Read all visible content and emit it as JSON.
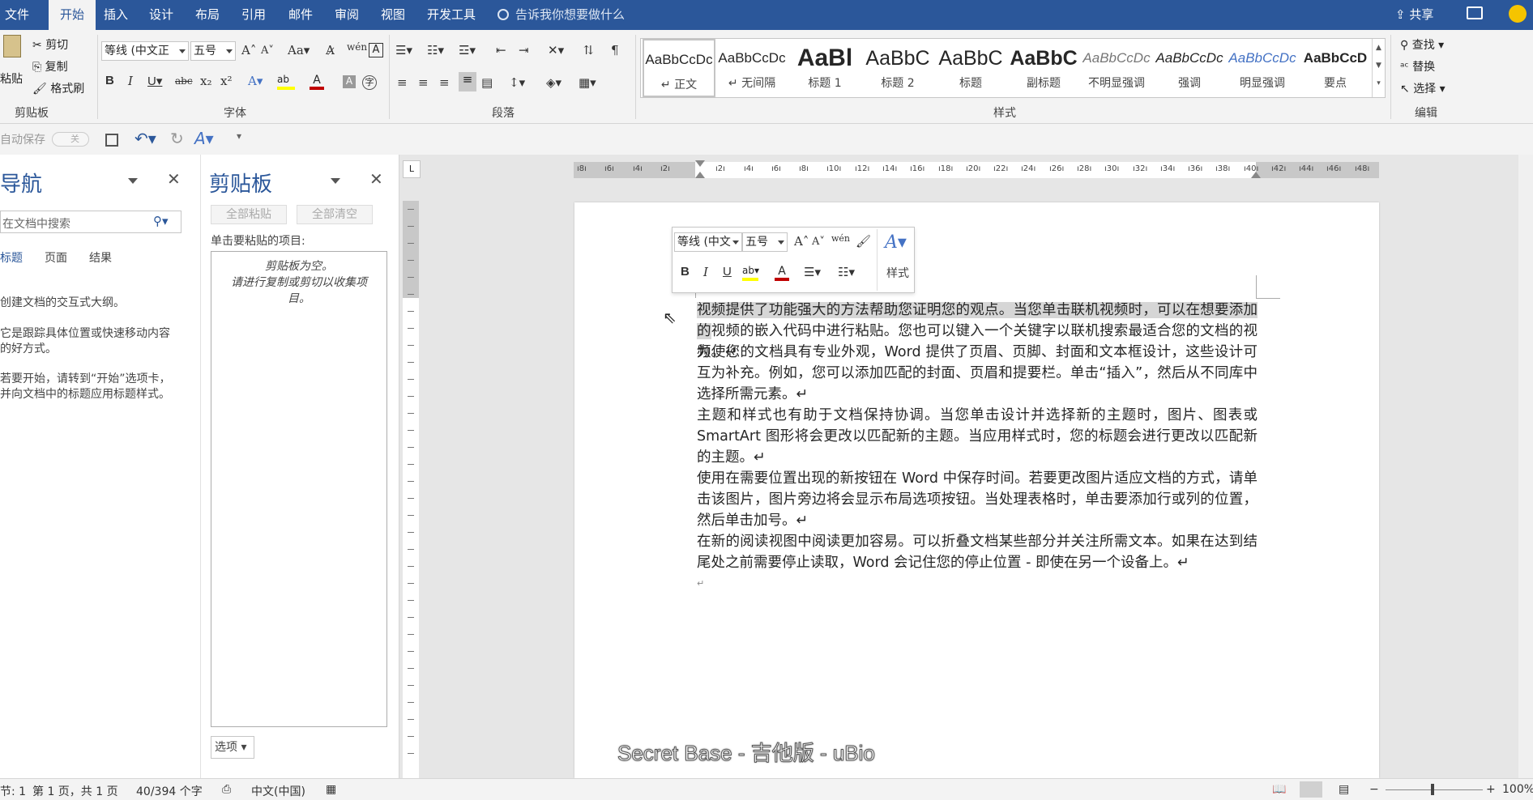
{
  "tabs": [
    "文件",
    "开始",
    "插入",
    "设计",
    "布局",
    "引用",
    "邮件",
    "审阅",
    "视图",
    "开发工具"
  ],
  "tell_me": "告诉我你想要做什么",
  "share": "共享",
  "clipboard_group": {
    "label": "剪贴板",
    "paste": "粘贴",
    "cut": "剪切",
    "copy": "复制",
    "format_painter": "格式刷"
  },
  "font_group": {
    "label": "字体",
    "font_name": "等线 (中文正",
    "font_size": "五号"
  },
  "paragraph_group": {
    "label": "段落"
  },
  "styles_group": {
    "label": "样式",
    "items": [
      {
        "sample": "AaBbCcDc",
        "name": "↵ 正文"
      },
      {
        "sample": "AaBbCcDc",
        "name": "↵ 无间隔"
      },
      {
        "sample": "AaBl",
        "name": "标题 1"
      },
      {
        "sample": "AaBbC",
        "name": "标题 2"
      },
      {
        "sample": "AaBbC",
        "name": "标题"
      },
      {
        "sample": "AaBbC",
        "name": "副标题"
      },
      {
        "sample": "AaBbCcDc",
        "name": "不明显强调"
      },
      {
        "sample": "AaBbCcDc",
        "name": "强调"
      },
      {
        "sample": "AaBbCcDc",
        "name": "明显强调"
      },
      {
        "sample": "AaBbCcD",
        "name": "要点"
      }
    ]
  },
  "edit_group": {
    "label": "编辑",
    "find": "查找",
    "replace": "替换",
    "select": "选择"
  },
  "qat": {
    "autosave": "自动保存",
    "autosave_state": "关"
  },
  "nav_pane": {
    "title": "导航",
    "search_placeholder": "在文档中搜索",
    "tabs": [
      "标题",
      "页面",
      "结果"
    ],
    "hint1": "创建文档的交互式大纲。",
    "hint2a": "它是跟踪具体位置或快速移动内容",
    "hint2b": "的好方式。",
    "hint3a": "若要开始，请转到“开始”选项卡，",
    "hint3b": "并向文档中的标题应用标题样式。"
  },
  "clip_pane": {
    "title": "剪贴板",
    "paste_all": "全部粘贴",
    "clear_all": "全部清空",
    "instruction": "单击要粘贴的项目:",
    "empty1": "剪贴板为空。",
    "empty2": "请进行复制或剪切以收集项",
    "empty3": "目。",
    "options": "选项"
  },
  "ruler_labels": [
    "8",
    "6",
    "4",
    "2",
    "",
    "2",
    "4",
    "6",
    "8",
    "10",
    "12",
    "14",
    "16",
    "18",
    "20",
    "22",
    "24",
    "26",
    "28",
    "30",
    "32",
    "34",
    "36",
    "38",
    "40",
    "42",
    "44",
    "46",
    "48"
  ],
  "mini_toolbar": {
    "font": "等线 (中文",
    "size": "五号",
    "styles": "样式"
  },
  "document": {
    "p1_highlight": "视频提供了功能强大的方法帮助您证明您的观点。当您单击联机视频时，可以在想要添加的",
    "p1_rest": "视频的嵌入代码中进行粘贴。您也可以键入一个关键字以联机搜索最适合您的文档的视频。↵",
    "p2": "为使您的文档具有专业外观，Word 提供了页眉、页脚、封面和文本框设计，这些设计可互为补充。例如，您可以添加匹配的封面、页眉和提要栏。单击“插入”，然后从不同库中选择所需元素。↵",
    "p3": "主题和样式也有助于文档保持协调。当您单击设计并选择新的主题时，图片、图表或 SmartArt 图形将会更改以匹配新的主题。当应用样式时，您的标题会进行更改以匹配新的主题。↵",
    "p4": "使用在需要位置出现的新按钮在 Word 中保存时间。若要更改图片适应文档的方式，请单击该图片，图片旁边将会显示布局选项按钮。当处理表格时，单击要添加行或列的位置，然后单击加号。↵",
    "p5": "在新的阅读视图中阅读更加容易。可以折叠文档某些部分并关注所需文本。如果在达到结尾处之前需要停止读取，Word 会记住您的停止位置 - 即使在另一个设备上。↵",
    "p6": "↵"
  },
  "watermark": "Secret Base - 吉他版 - uBio",
  "status": {
    "section": "节: 1",
    "page": "第 1 页，共 1 页",
    "words": "40/394 个字",
    "language": "中文(中国)",
    "zoom": "100%"
  },
  "colors": {
    "accent": "#2b579a",
    "ribbon": "#f3f3f3"
  }
}
